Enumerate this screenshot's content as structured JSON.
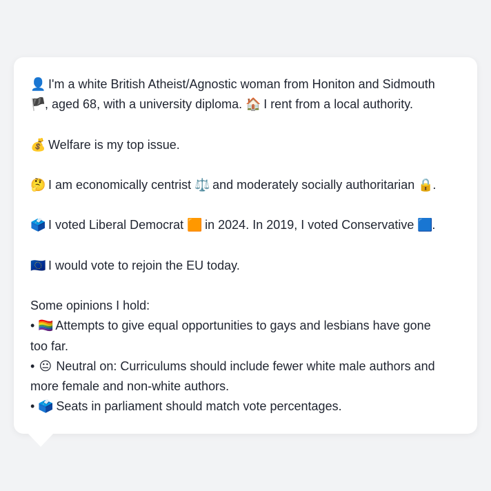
{
  "profile": {
    "p1_icon": "👤",
    "p1_a": "I'm a white British Atheist/Agnostic woman from Honiton and Sidmouth",
    "p1_flag": "🏴",
    "p1_b": ", aged 68, with a university diploma.",
    "p1_house": "🏠",
    "p1_c": "I rent from a local authority.",
    "p2_icon": "💰",
    "p2_text": "Welfare is my top issue.",
    "p3_icon": "🤔",
    "p3_a": "I am economically centrist",
    "p3_scale": "⚖️",
    "p3_b": "and moderately socially authoritarian",
    "p3_lock": "🔒",
    "p3_end": ".",
    "p4_icon": "🗳️",
    "p4_a": "I voted Liberal Democrat",
    "p4_sq1": "🟧",
    "p4_b": "in 2024. In 2019, I voted Conservative",
    "p4_sq2": "🟦",
    "p4_end": ".",
    "p5_icon": "🇪🇺",
    "p5_text": "I would vote to rejoin the EU today.",
    "opinions_heading": "Some opinions I hold:",
    "op1_icon": "🏳️‍🌈",
    "op1_text": "Attempts to give equal opportunities to gays and lesbians have gone",
    "op1_text2": "too far.",
    "op2_icon": "😐",
    "op2_text": "Neutral on: Curriculums should include fewer white male authors and",
    "op2_text2": "more female and non-white authors.",
    "op3_icon": "🗳️",
    "op3_text": "Seats in parliament should match vote percentages.",
    "bullet": "•"
  }
}
